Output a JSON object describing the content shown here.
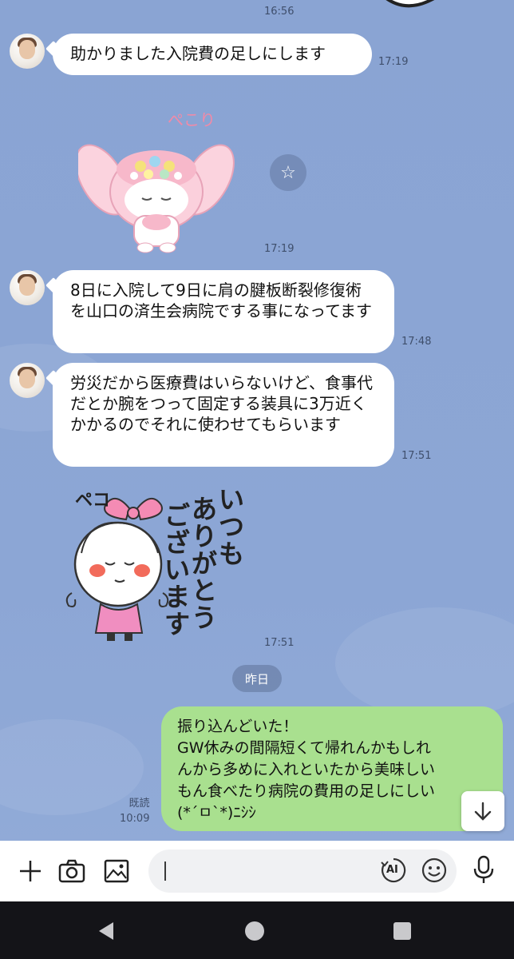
{
  "messages": {
    "top_partial_time": "16:56",
    "m1": {
      "text": "助かりました入院費の足しにします",
      "time": "17:19"
    },
    "sticker1": {
      "caption": "ぺこり",
      "time": "17:19"
    },
    "m2": {
      "text": "8日に入院して9日に肩の腱板断裂修復術を山口の済生会病院でする事になってます",
      "time": "17:48"
    },
    "m3": {
      "text": "労災だから医療費はいらないけど、食事代だとか腕をつって固定する装具に3万近くかかるのでそれに使わせてもらいます",
      "time": "17:51"
    },
    "sticker2": {
      "line1": "いつも",
      "line2": "ありがとう",
      "line3": "ございます",
      "peko": "ペコ",
      "time": "17:51"
    },
    "date_separator": "昨日",
    "m4": {
      "line1": "振り込んどいた！",
      "line2": "GW休みの間隔短くて帰れんかもしれ",
      "line3": "んから多めに入れといたから美味しい",
      "line4": "もん食べたり病院の費用の足しにしい",
      "line5": "(*´ㅁ`*)ﾆｼｼ",
      "read_label": "既読",
      "time": "10:09"
    }
  },
  "input_bar": {
    "placeholder": "",
    "icons": [
      "plus-icon",
      "camera-icon",
      "image-icon",
      "ai-icon",
      "emoji-icon",
      "microphone-icon"
    ],
    "ai_label": "AI"
  },
  "nav": {
    "icons": [
      "back-icon",
      "home-icon",
      "recents-icon"
    ]
  },
  "colors": {
    "background": "#8aa4d3",
    "incoming_bubble": "#ffffff",
    "outgoing_bubble": "#a9e08f"
  }
}
